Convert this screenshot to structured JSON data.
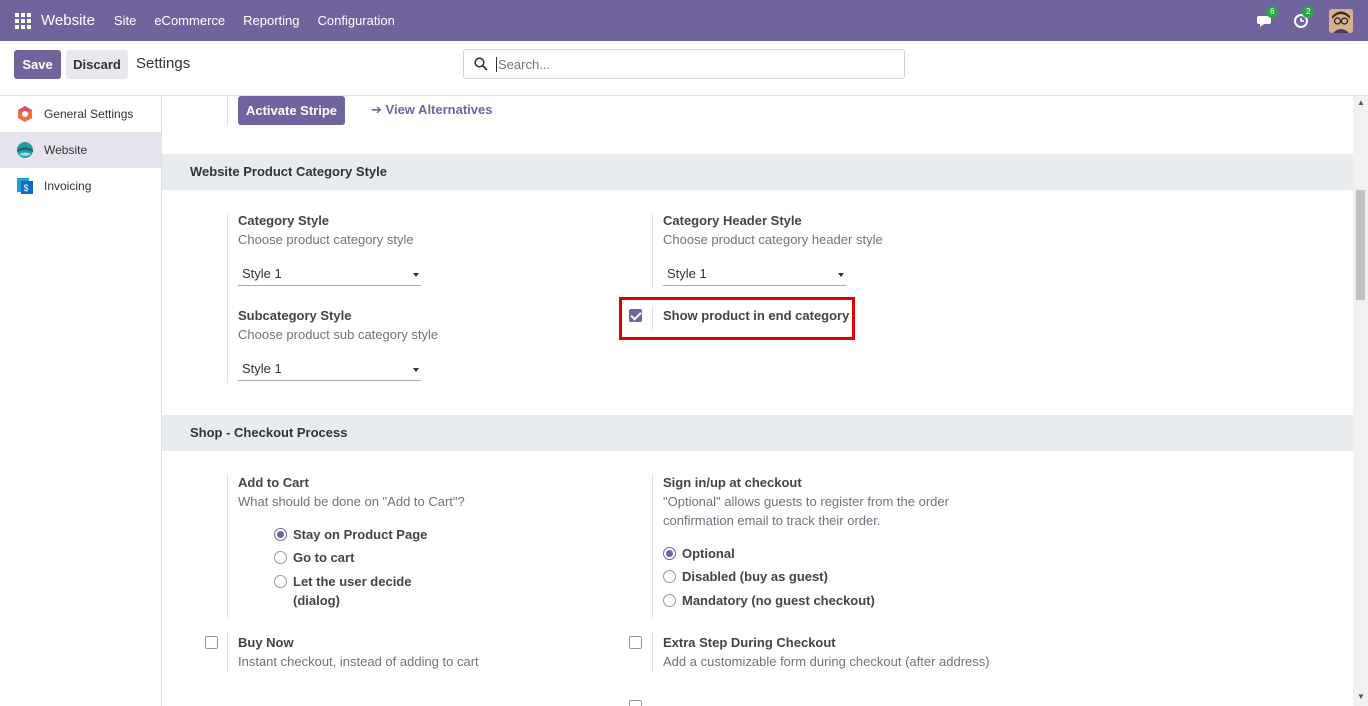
{
  "navbar": {
    "brand": "Website",
    "menu": [
      "Site",
      "eCommerce",
      "Reporting",
      "Configuration"
    ],
    "messages_count": "6",
    "activities_count": "2"
  },
  "control": {
    "save_label": "Save",
    "discard_label": "Discard",
    "title": "Settings",
    "search_placeholder": "Search..."
  },
  "sidebar": {
    "items": [
      {
        "label": "General Settings",
        "icon": "general-settings-icon"
      },
      {
        "label": "Website",
        "icon": "website-icon"
      },
      {
        "label": "Invoicing",
        "icon": "invoicing-icon"
      }
    ]
  },
  "payment": {
    "activate_label": "Activate Stripe",
    "alternatives_label": "View Alternatives"
  },
  "category_section": {
    "title": "Website Product Category Style",
    "category_style": {
      "title": "Category Style",
      "desc": "Choose product category style",
      "value": "Style 1"
    },
    "category_header_style": {
      "title": "Category Header Style",
      "desc": "Choose product category header style",
      "value": "Style 1"
    },
    "subcategory_style": {
      "title": "Subcategory Style",
      "desc": "Choose product sub category style",
      "value": "Style 1"
    },
    "show_product_end": {
      "label": "Show product in end category",
      "checked": true
    }
  },
  "checkout_section": {
    "title": "Shop - Checkout Process",
    "add_to_cart": {
      "title": "Add to Cart",
      "desc": "What should be done on \"Add to Cart\"?",
      "options": [
        "Stay on Product Page",
        "Go to cart",
        "Let the user decide",
        "(dialog)"
      ],
      "selected": "Stay on Product Page"
    },
    "sign_in": {
      "title": "Sign in/up at checkout",
      "desc1": "\"Optional\" allows guests to register from the order",
      "desc2": "confirmation email to track their order.",
      "options": [
        "Optional",
        "Disabled (buy as guest)",
        "Mandatory (no guest checkout)"
      ],
      "selected": "Optional"
    },
    "buy_now": {
      "title": "Buy Now",
      "desc": "Instant checkout, instead of adding to cart",
      "checked": false
    },
    "extra_step": {
      "title": "Extra Step During Checkout",
      "desc": "Add a customizable form during checkout (after address)",
      "checked": false
    }
  },
  "colors": {
    "primary": "#71639e",
    "highlight": "#e00000"
  }
}
